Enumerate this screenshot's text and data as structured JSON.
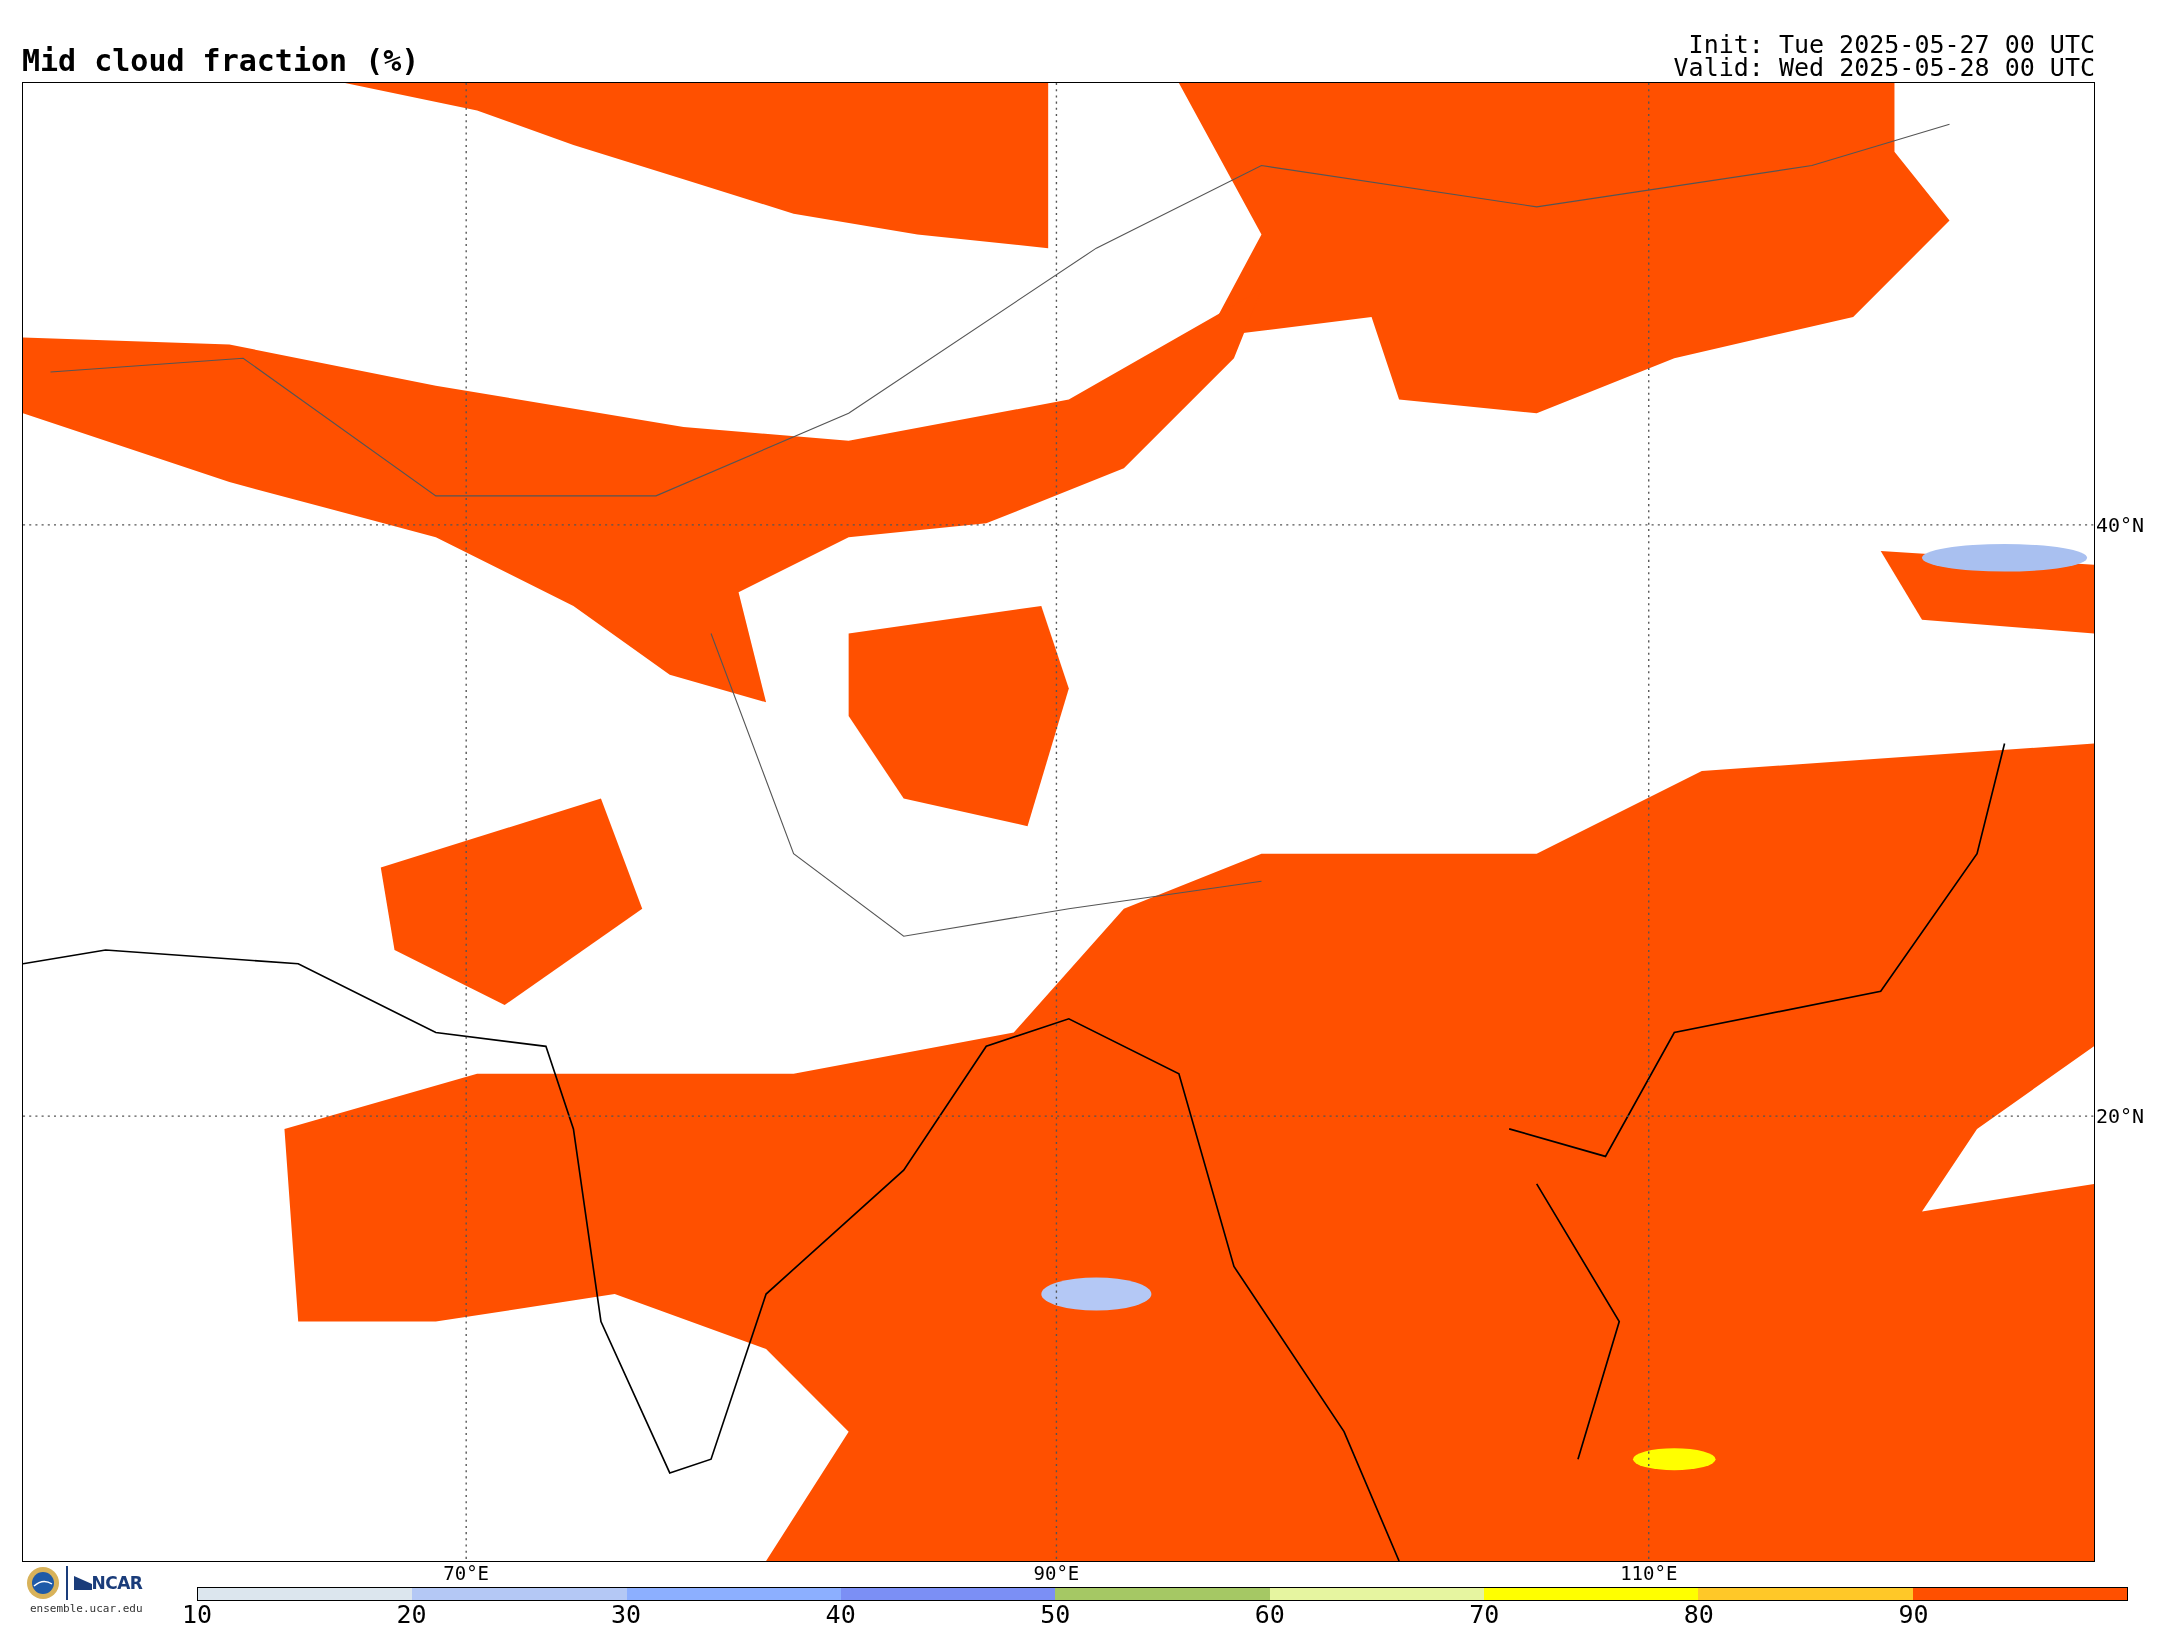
{
  "title": "Mid cloud fraction (%)",
  "init": "Init: Tue 2025-05-27 00 UTC",
  "valid": "Valid: Wed 2025-05-28 00 UTC",
  "map": {
    "kind": "map-picture"
  },
  "lat_labels": [
    "40°N",
    "20°N"
  ],
  "lon_labels": [
    "70°E",
    "90°E",
    "110°E"
  ],
  "logo": {
    "org": "NCAR",
    "url": "ensemble.ucar.edu"
  },
  "colorbar": {
    "ticks": [
      "10",
      "20",
      "30",
      "40",
      "50",
      "60",
      "70",
      "80",
      "90"
    ],
    "segments": [
      {
        "color": "#dce6ee"
      },
      {
        "color": "#b4c8f5"
      },
      {
        "color": "#8cafff"
      },
      {
        "color": "#7b8ff5"
      },
      {
        "color": "#a5c864"
      },
      {
        "color": "#e6f5a0"
      },
      {
        "color": "#ffff00"
      },
      {
        "color": "#ffc828"
      },
      {
        "color": "#ff5000"
      }
    ]
  }
}
